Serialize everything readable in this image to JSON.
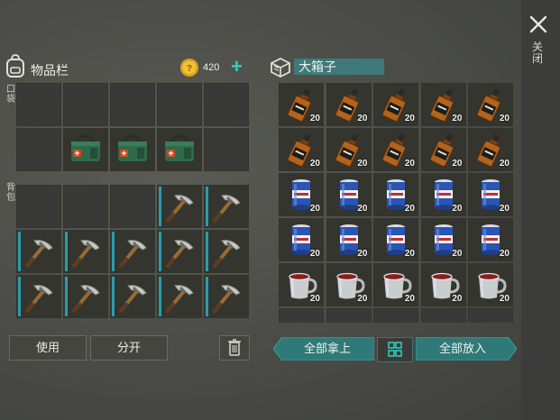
{
  "close": {
    "label": "关闭"
  },
  "inventory": {
    "title": "物品栏",
    "coins": "420",
    "pocket_label": "口袋",
    "backpack_label": "背包",
    "pocket_slots": [
      {
        "item": "empty"
      },
      {
        "item": "empty"
      },
      {
        "item": "empty"
      },
      {
        "item": "empty"
      },
      {
        "item": "empty"
      },
      {
        "item": "empty"
      },
      {
        "item": "medkit"
      },
      {
        "item": "medkit"
      },
      {
        "item": "medkit"
      },
      {
        "item": "empty"
      }
    ],
    "backpack_slots": [
      {
        "item": "empty"
      },
      {
        "item": "empty"
      },
      {
        "item": "empty"
      },
      {
        "item": "pickaxe"
      },
      {
        "item": "pickaxe"
      },
      {
        "item": "pickaxe"
      },
      {
        "item": "pickaxe"
      },
      {
        "item": "pickaxe"
      },
      {
        "item": "pickaxe"
      },
      {
        "item": "pickaxe"
      },
      {
        "item": "pickaxe"
      },
      {
        "item": "pickaxe"
      },
      {
        "item": "pickaxe"
      },
      {
        "item": "pickaxe"
      },
      {
        "item": "pickaxe"
      }
    ],
    "use_label": "使用",
    "split_label": "分开"
  },
  "chest": {
    "title": "大箱子",
    "slots": [
      {
        "item": "whiskey",
        "count": "20"
      },
      {
        "item": "whiskey",
        "count": "20"
      },
      {
        "item": "whiskey",
        "count": "20"
      },
      {
        "item": "whiskey",
        "count": "20"
      },
      {
        "item": "whiskey",
        "count": "20"
      },
      {
        "item": "whiskey",
        "count": "20"
      },
      {
        "item": "whiskey",
        "count": "20"
      },
      {
        "item": "whiskey",
        "count": "20"
      },
      {
        "item": "whiskey",
        "count": "20"
      },
      {
        "item": "whiskey",
        "count": "20"
      },
      {
        "item": "soda-can",
        "count": "20"
      },
      {
        "item": "soda-can",
        "count": "20"
      },
      {
        "item": "soda-can",
        "count": "20"
      },
      {
        "item": "soda-can",
        "count": "20"
      },
      {
        "item": "soda-can",
        "count": "20"
      },
      {
        "item": "soda-can",
        "count": "20"
      },
      {
        "item": "soda-can",
        "count": "20"
      },
      {
        "item": "soda-can",
        "count": "20"
      },
      {
        "item": "soda-can",
        "count": "20"
      },
      {
        "item": "soda-can",
        "count": "20"
      },
      {
        "item": "mug",
        "count": "20"
      },
      {
        "item": "mug",
        "count": "20"
      },
      {
        "item": "mug",
        "count": "20"
      },
      {
        "item": "mug",
        "count": "20"
      },
      {
        "item": "mug",
        "count": "20"
      }
    ],
    "take_all_label": "全部拿上",
    "put_all_label": "全部放入"
  },
  "colors": {
    "accent": "#2f7a78",
    "teal_plus": "#2fd1c3",
    "durability": "#2a9dab"
  }
}
